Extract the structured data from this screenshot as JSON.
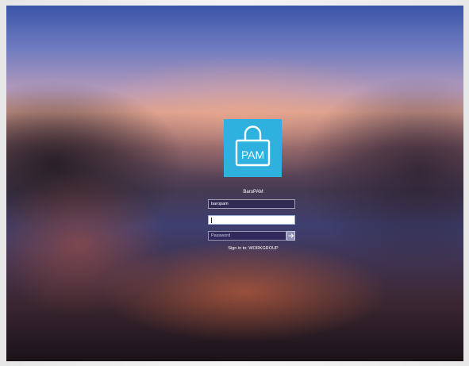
{
  "login": {
    "logo_text": "PAM",
    "user_name": "BaroPAM",
    "username_value": "baropam",
    "domain_value": "",
    "password_placeholder": "Password",
    "sign_in_label": "Sign in to: WORKGROUP"
  },
  "icons": {
    "logo": "padlock-icon",
    "submit": "arrow-right-icon"
  },
  "colors": {
    "logo_background": "#2eb1df",
    "field_background": "#2e2852"
  }
}
